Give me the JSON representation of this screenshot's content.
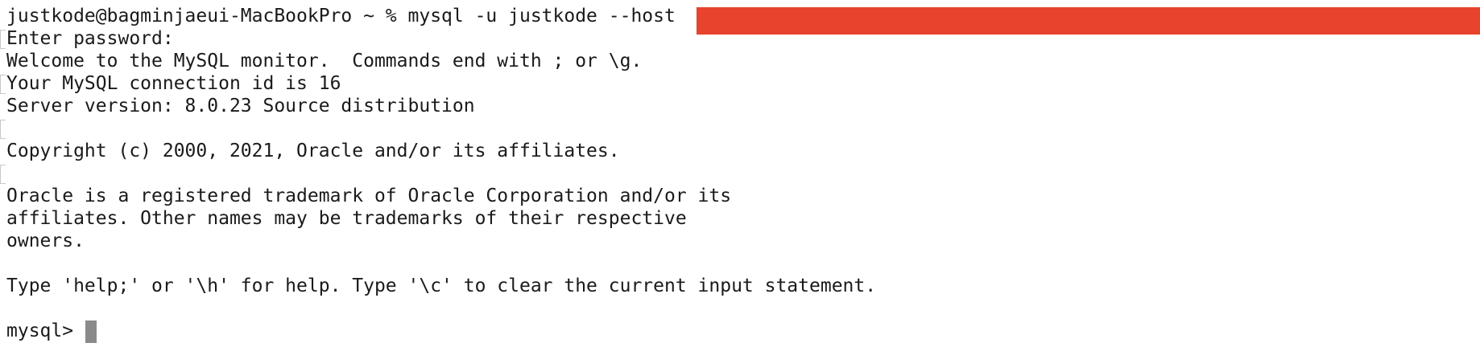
{
  "terminal": {
    "redaction_color": "#e8432c",
    "cursor_color": "#8a8a8a",
    "lines": {
      "command": "justkode@bagminjaeui-MacBookPro ~ % mysql -u justkode --host",
      "password_prompt": "Enter password:",
      "welcome": "Welcome to the MySQL monitor.  Commands end with ; or \\g.",
      "connection_id": "Your MySQL connection id is 16",
      "server_version": "Server version: 8.0.23 Source distribution",
      "copyright": "Copyright (c) 2000, 2021, Oracle and/or its affiliates.",
      "trademark_1": "Oracle is a registered trademark of Oracle Corporation and/or its",
      "trademark_2": "affiliates. Other names may be trademarks of their respective",
      "trademark_3": "owners.",
      "help": "Type 'help;' or '\\h' for help. Type '\\c' to clear the current input statement.",
      "prompt": "mysql>"
    }
  }
}
